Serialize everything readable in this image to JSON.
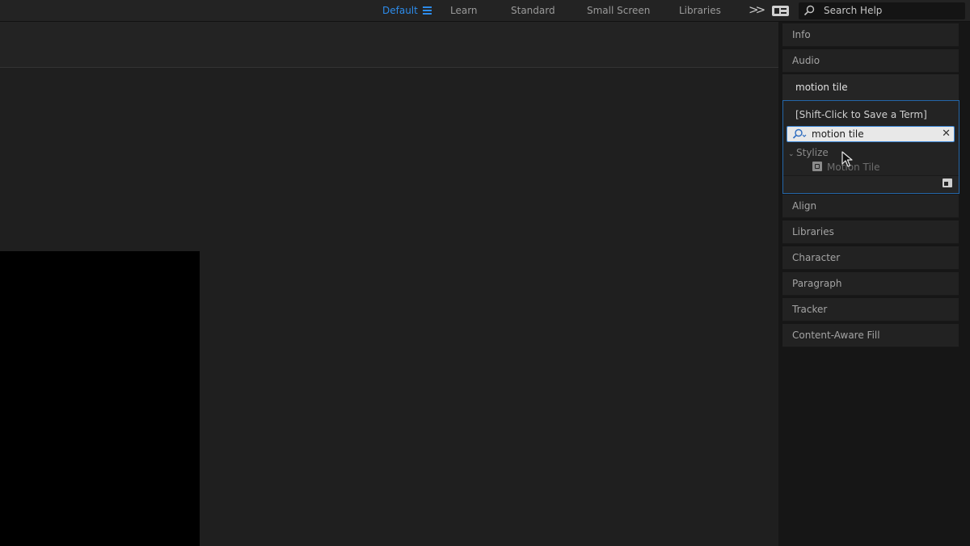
{
  "workspace_bar": {
    "tabs": [
      {
        "label": "Default",
        "active": true
      },
      {
        "label": "Learn",
        "active": false
      },
      {
        "label": "Standard",
        "active": false
      },
      {
        "label": "Small Screen",
        "active": false
      },
      {
        "label": "Libraries",
        "active": false
      }
    ],
    "menu_icon": "hamburger-menu-icon",
    "overflow_icon": "double-chevron-right-icon",
    "toggle_icon": "workspace-toggle-icon",
    "help_search": {
      "placeholder": "Search Help",
      "icon": "search-icon"
    },
    "accent_color": "#2d8ceb"
  },
  "right_panels": {
    "top_tabs": [
      "Info",
      "Audio"
    ],
    "bottom_tabs": [
      "Align",
      "Libraries",
      "Character",
      "Paragraph",
      "Tracker",
      "Content-Aware Fill"
    ]
  },
  "effects_panel": {
    "title": "motion tile",
    "save_hint": "[Shift-Click to Save a Term]",
    "search": {
      "value": "motion tile",
      "icon": "search-dropdown-icon",
      "clear_icon": "close-icon",
      "clear_glyph": "✕"
    },
    "tree": {
      "category": "Stylize",
      "category_caret": "⌄",
      "items": [
        "Motion Tile"
      ],
      "item_icon": "effect-icon"
    },
    "footer_icon": "new-bin-icon"
  }
}
